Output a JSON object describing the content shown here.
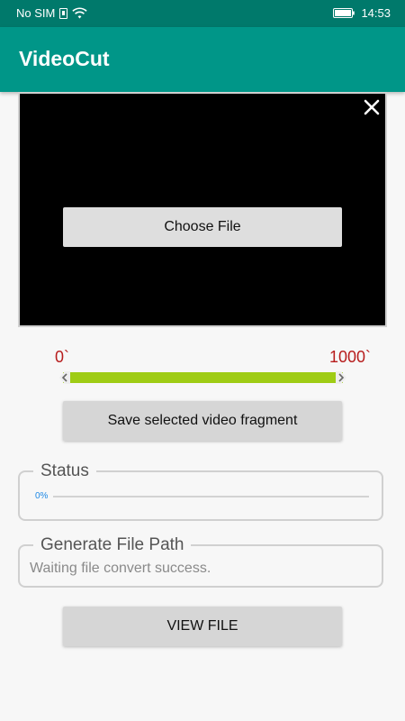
{
  "status_bar": {
    "carrier": "No SIM",
    "time": "14:53"
  },
  "app_bar": {
    "title": "VideoCut"
  },
  "video": {
    "choose_file_label": "Choose File"
  },
  "range": {
    "min_label": "0`",
    "max_label": "1000`",
    "selected_start_fraction": 0,
    "selected_end_fraction": 1
  },
  "save_fragment_label": "Save selected video fragment",
  "status_panel": {
    "title": "Status",
    "progress_label": "0%",
    "progress_fraction": 0
  },
  "path_panel": {
    "title": "Generate File Path",
    "text": "Waiting file convert success."
  },
  "view_file_label": "VIEW FILE",
  "colors": {
    "app_bar": "#009688",
    "status_bar": "#00796b",
    "range_fill": "#9fcc15",
    "range_labels": "#b71c1c",
    "progress": "#1e88e5"
  }
}
